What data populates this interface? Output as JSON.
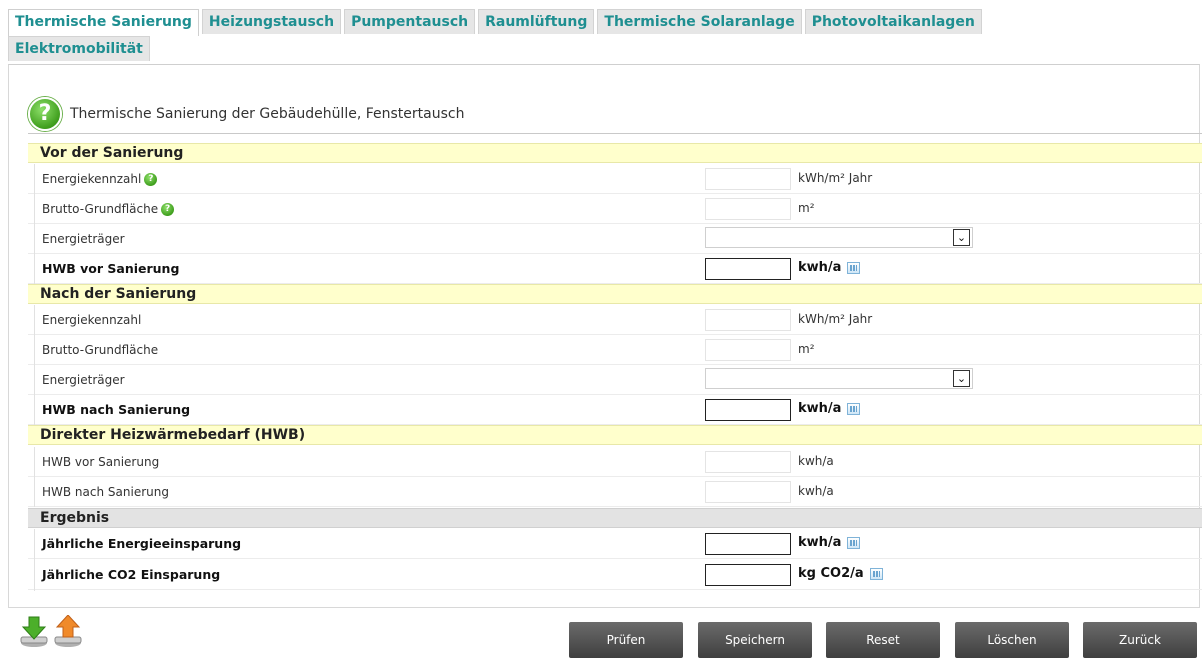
{
  "tabs": {
    "row1": [
      "Thermische Sanierung",
      "Heizungstausch",
      "Pumpentausch",
      "Raumlüftung",
      "Thermische Solaranlage",
      "Photovoltaikanlagen"
    ],
    "row2": [
      "Elektromobilität"
    ],
    "active": "Thermische Sanierung"
  },
  "header": {
    "title": "Thermische Sanierung der Gebäudehülle, Fenstertausch",
    "help_icon": "?"
  },
  "sections": {
    "vor": {
      "title": "Vor der Sanierung",
      "energiekennzahl": {
        "label": "Energiekennzahl",
        "unit": "kWh/m² Jahr",
        "value": ""
      },
      "brutto": {
        "label": "Brutto-Grundfläche",
        "unit": "m²",
        "value": ""
      },
      "energietraeger": {
        "label": "Energieträger",
        "value": ""
      },
      "hwb": {
        "label": "HWB vor Sanierung",
        "unit": "kwh/a",
        "value": ""
      }
    },
    "nach": {
      "title": "Nach der Sanierung",
      "energiekennzahl": {
        "label": "Energiekennzahl",
        "unit": "kWh/m² Jahr",
        "value": ""
      },
      "brutto": {
        "label": "Brutto-Grundfläche",
        "unit": "m²",
        "value": ""
      },
      "energietraeger": {
        "label": "Energieträger",
        "value": ""
      },
      "hwb": {
        "label": "HWB nach Sanierung",
        "unit": "kwh/a",
        "value": ""
      }
    },
    "direkt": {
      "title": "Direkter Heizwärmebedarf (HWB)",
      "vor": {
        "label": "HWB vor Sanierung",
        "unit": "kwh/a",
        "value": ""
      },
      "nach": {
        "label": "HWB nach Sanierung",
        "unit": "kwh/a",
        "value": ""
      }
    },
    "ergebnis": {
      "title": "Ergebnis",
      "energie": {
        "label": "Jährliche Energieeinsparung",
        "unit": "kwh/a",
        "value": ""
      },
      "co2": {
        "label": "Jährliche CO2 Einsparung",
        "unit": "kg CO2/a",
        "value": ""
      }
    }
  },
  "footer": {
    "buttons": [
      "Prüfen",
      "Speichern",
      "Reset",
      "Löschen",
      "Zurück"
    ],
    "icons": [
      "download-icon",
      "upload-icon"
    ]
  },
  "colors": {
    "tab_text": "#1f8f91",
    "section_bg": "#ffffcc",
    "result_bg": "#e3e3e3",
    "button_bg": "#4a4a4a"
  }
}
